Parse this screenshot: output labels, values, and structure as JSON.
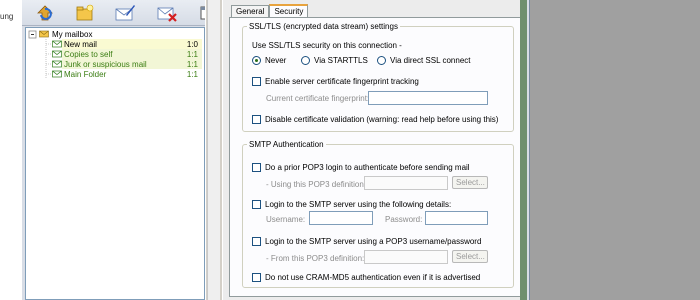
{
  "behind_fragment": "ung",
  "toolbar": {
    "icons": [
      "refresh-icon",
      "new-folder-icon",
      "compose-icon",
      "delete-icon",
      "window-icon"
    ]
  },
  "tree": {
    "root": {
      "label": "My mailbox"
    },
    "items": [
      {
        "label": "New mail",
        "count": "1:0"
      },
      {
        "label": "Copies to self",
        "count": "1:1"
      },
      {
        "label": "Junk or suspicious mail",
        "count": "1:1"
      },
      {
        "label": "Main Folder",
        "count": "1:1"
      }
    ]
  },
  "dialog": {
    "tabs": [
      "General",
      "Security"
    ],
    "ssl": {
      "legend": "SSL/TLS (encrypted data stream) settings",
      "use_label": "Use SSL/TLS security on this connection -",
      "options": [
        "Never",
        "Via STARTTLS",
        "Via direct SSL connect"
      ],
      "selected": "Never",
      "fingerprint_check": "Enable server certificate fingerprint tracking",
      "fingerprint_label": "Current certificate fingerprint:",
      "disable_validation": "Disable certificate validation (warning: read help before using this)"
    },
    "smtp": {
      "legend": "SMTP Authentication",
      "pop3_before": "Do a prior POP3 login to authenticate before sending mail",
      "pop3_def_label1": "- Using this POP3 definition:",
      "select_label": "Select...",
      "login_smtp": "Login to the SMTP server using the following details:",
      "username_label": "Username:",
      "password_label": "Password:",
      "login_pop3": "Login to the SMTP server using a POP3 username/password",
      "pop3_def_label2": "- From this POP3 definition:",
      "no_crammd5": "Do not use CRAM-MD5 authentication even if it is advertised"
    }
  }
}
